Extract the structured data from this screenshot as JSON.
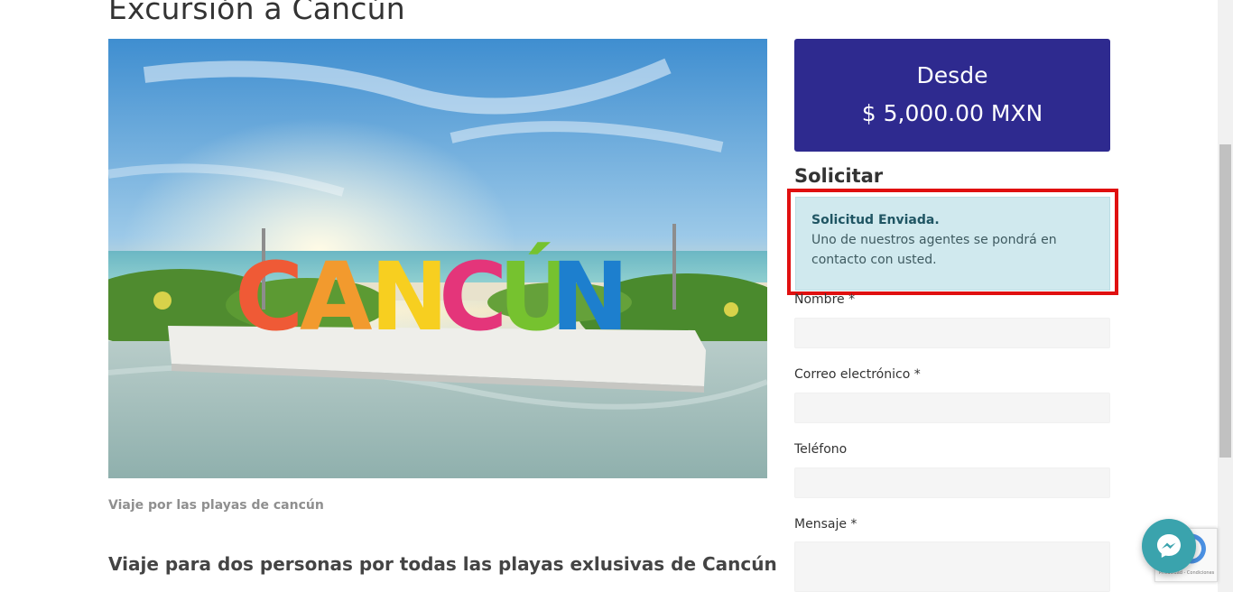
{
  "page": {
    "title": "Excursión a Cancún",
    "image_caption": "Viaje por las playas de cancún",
    "subheading": "Viaje para dos personas por todas las playas exlusivas de Cancún"
  },
  "hero_image": {
    "sign_letters": [
      "C",
      "A",
      "N",
      "C",
      "Ú",
      "N"
    ]
  },
  "price": {
    "from_label": "Desde",
    "amount": "$ 5,000.00 MXN"
  },
  "form": {
    "heading": "Solicitar",
    "alert": {
      "title": "Solicitud Enviada.",
      "message": "Uno de nuestros agentes se pondrá en contacto con usted."
    },
    "fields": {
      "name_label": "Nombre *",
      "email_label": "Correo electrónico *",
      "phone_label": "Teléfono",
      "message_label": "Mensaje *"
    }
  },
  "recaptcha": {
    "text": "Privacidad - Condiciones"
  },
  "colors": {
    "price_box": "#2e2a8f",
    "alert_bg": "#d0e9ee",
    "highlight_border": "#e01010",
    "messenger": "#3aa3ad"
  },
  "icons": {
    "messenger": "messenger-icon",
    "recaptcha": "recaptcha-icon"
  }
}
